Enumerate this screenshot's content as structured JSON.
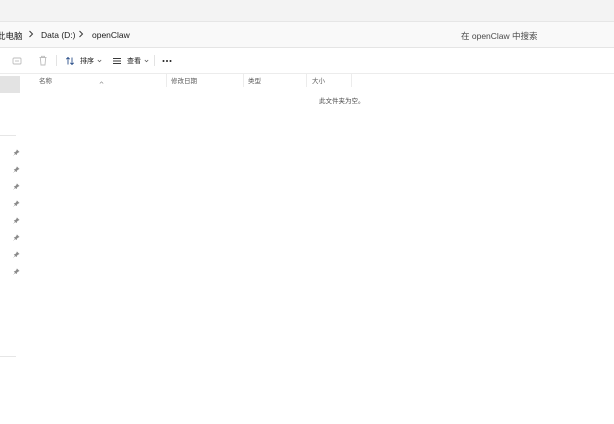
{
  "breadcrumb": {
    "items": [
      {
        "label": "此电脑"
      },
      {
        "label": "Data (D:)"
      },
      {
        "label": "openClaw"
      }
    ]
  },
  "search": {
    "placeholder": "在 openClaw 中搜索"
  },
  "toolbar": {
    "sort_label": "排序",
    "view_label": "查看",
    "more_label": "···"
  },
  "columns": {
    "name": "名称",
    "modified": "修改日期",
    "type": "类型",
    "size": "大小"
  },
  "empty_message": "此文件夹为空。",
  "colors": {
    "address_bg": "#f9f9f9",
    "selected_nav": "#e3e3e3"
  }
}
